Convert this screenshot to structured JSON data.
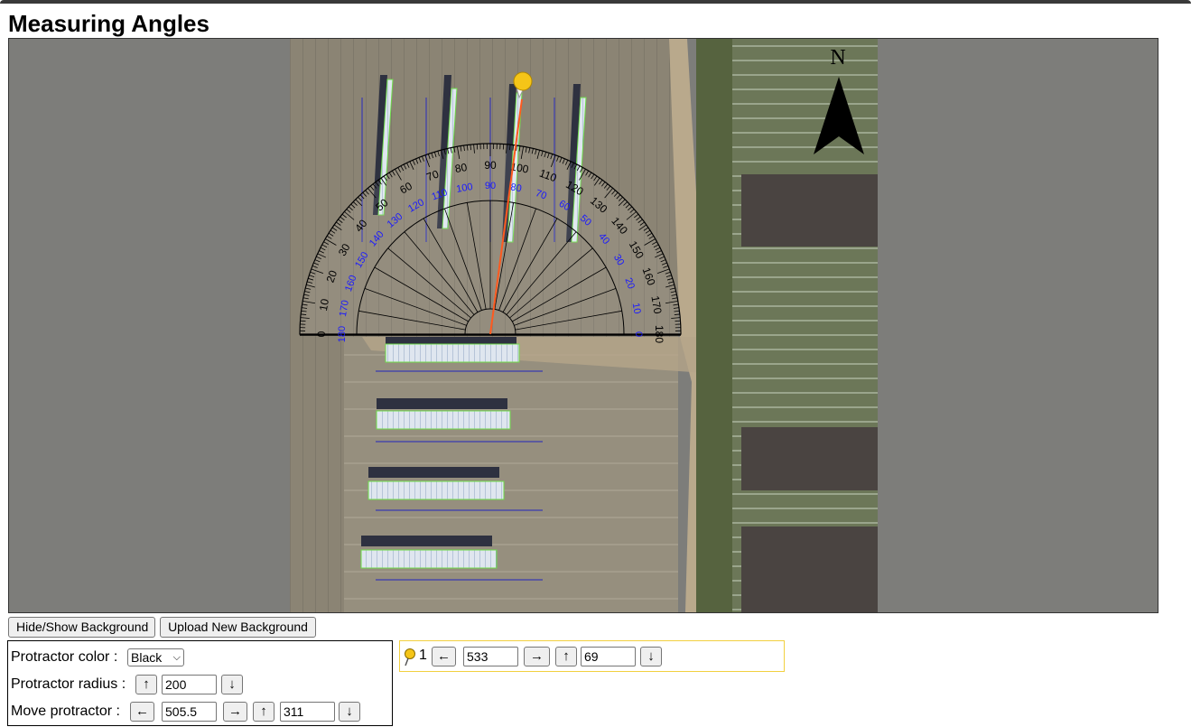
{
  "page": {
    "title": "Measuring Angles"
  },
  "canvas": {
    "background_color": "#7d7d7a",
    "compass_label": "N",
    "protractor_outer_labels": [
      "0",
      "10",
      "20",
      "30",
      "40",
      "50",
      "60",
      "70",
      "80",
      "90",
      "100",
      "110",
      "120",
      "130",
      "140",
      "150",
      "160",
      "170",
      "180"
    ],
    "protractor_inner_labels": [
      "180",
      "170",
      "160",
      "150",
      "140",
      "130",
      "120",
      "110",
      "100",
      "90",
      "80",
      "70",
      "60",
      "50",
      "40",
      "30",
      "20",
      "10",
      "0"
    ],
    "pin_color": "#f5c518",
    "measure_line_color": "#ff5a1f",
    "inner_scale_color": "#1a1aff"
  },
  "buttons": {
    "toggle_background": "Hide/Show Background",
    "upload_background": "Upload New Background"
  },
  "controls": {
    "color_label": "Protractor color :",
    "color_value": "Black",
    "radius_label": "Protractor radius :",
    "radius_value": "200",
    "move_label": "Move protractor :",
    "move_x_value": "505.5",
    "move_y_value": "311"
  },
  "pin": {
    "number": "1",
    "x_value": "533",
    "y_value": "69"
  },
  "arrows": {
    "left": "←",
    "right": "→",
    "up": "↑",
    "down": "↓"
  }
}
